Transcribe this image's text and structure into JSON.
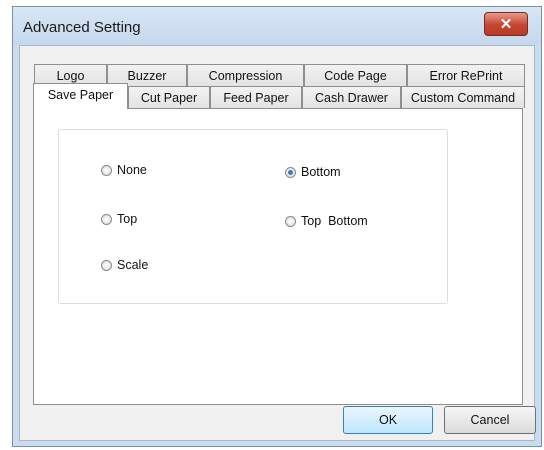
{
  "window": {
    "title": "Advanced Setting",
    "close_glyph": "✕"
  },
  "tabs_row1": [
    {
      "label": "Logo"
    },
    {
      "label": "Buzzer"
    },
    {
      "label": "Compression"
    },
    {
      "label": "Code Page"
    },
    {
      "label": "Error RePrint"
    }
  ],
  "tabs_row2": [
    {
      "label": "Save Paper",
      "active": true
    },
    {
      "label": "Cut Paper"
    },
    {
      "label": "Feed Paper"
    },
    {
      "label": "Cash Drawer"
    },
    {
      "label": "Custom Command"
    }
  ],
  "save_paper": {
    "options": [
      {
        "label": "None",
        "checked": false
      },
      {
        "label": "Bottom",
        "checked": true
      },
      {
        "label": "Top",
        "checked": false
      },
      {
        "label": "Top  Bottom",
        "checked": false
      },
      {
        "label": "Scale",
        "checked": false
      }
    ]
  },
  "buttons": {
    "ok": "OK",
    "cancel": "Cancel"
  },
  "colors": {
    "title_bar": "#c9dcf0",
    "close_button": "#c4452f",
    "radio_checked": "#3c7bc8"
  }
}
